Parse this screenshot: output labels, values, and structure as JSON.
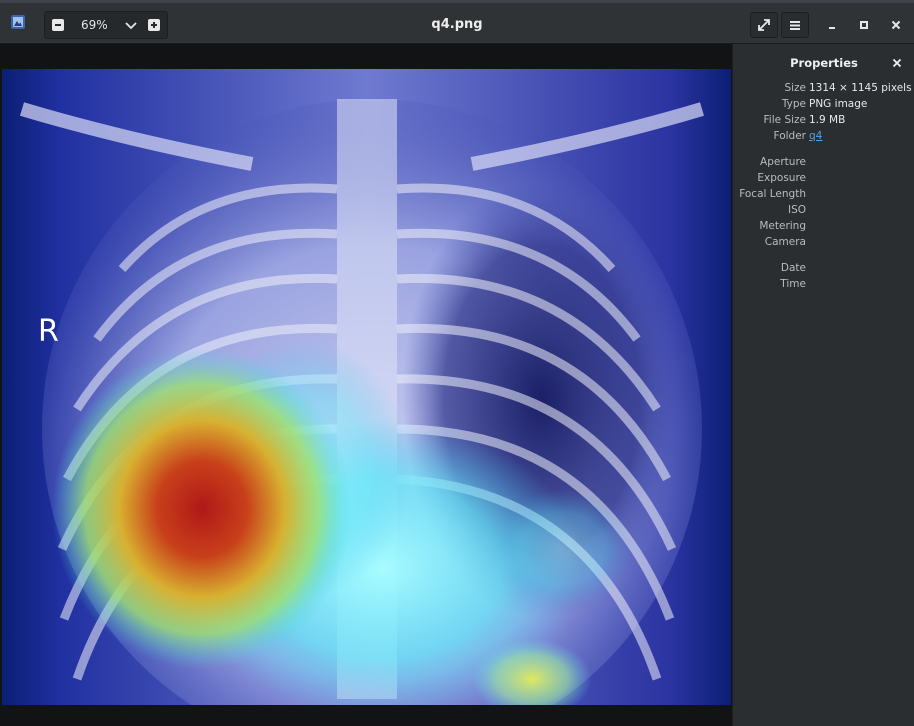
{
  "window": {
    "title": "q4.png"
  },
  "toolbar": {
    "zoom_value": "69%",
    "zoom_out_icon": "minus-icon",
    "zoom_in_icon": "plus-icon",
    "zoom_dropdown_icon": "chevron-down-icon",
    "fullscreen_icon": "fullscreen-icon",
    "menu_icon": "hamburger-menu-icon",
    "minimize_icon": "minimize-icon",
    "maximize_icon": "maximize-icon",
    "close_icon": "close-icon"
  },
  "image": {
    "marker_text": "R"
  },
  "properties": {
    "title": "Properties",
    "rows": [
      {
        "label": "Size",
        "value": "1314 × 1145 pixels"
      },
      {
        "label": "Type",
        "value": "PNG image"
      },
      {
        "label": "File Size",
        "value": "1.9 MB"
      },
      {
        "label": "Folder",
        "value": "q4"
      },
      {
        "label": "Aperture",
        "value": ""
      },
      {
        "label": "Exposure",
        "value": ""
      },
      {
        "label": "Focal Length",
        "value": ""
      },
      {
        "label": "ISO",
        "value": ""
      },
      {
        "label": "Metering",
        "value": ""
      },
      {
        "label": "Camera",
        "value": ""
      },
      {
        "label": "Date",
        "value": ""
      },
      {
        "label": "Time",
        "value": ""
      }
    ]
  },
  "colors": {
    "titlebar_bg": "#2f3336",
    "panel_bg": "#2a2e31",
    "link": "#5aa2e0"
  }
}
